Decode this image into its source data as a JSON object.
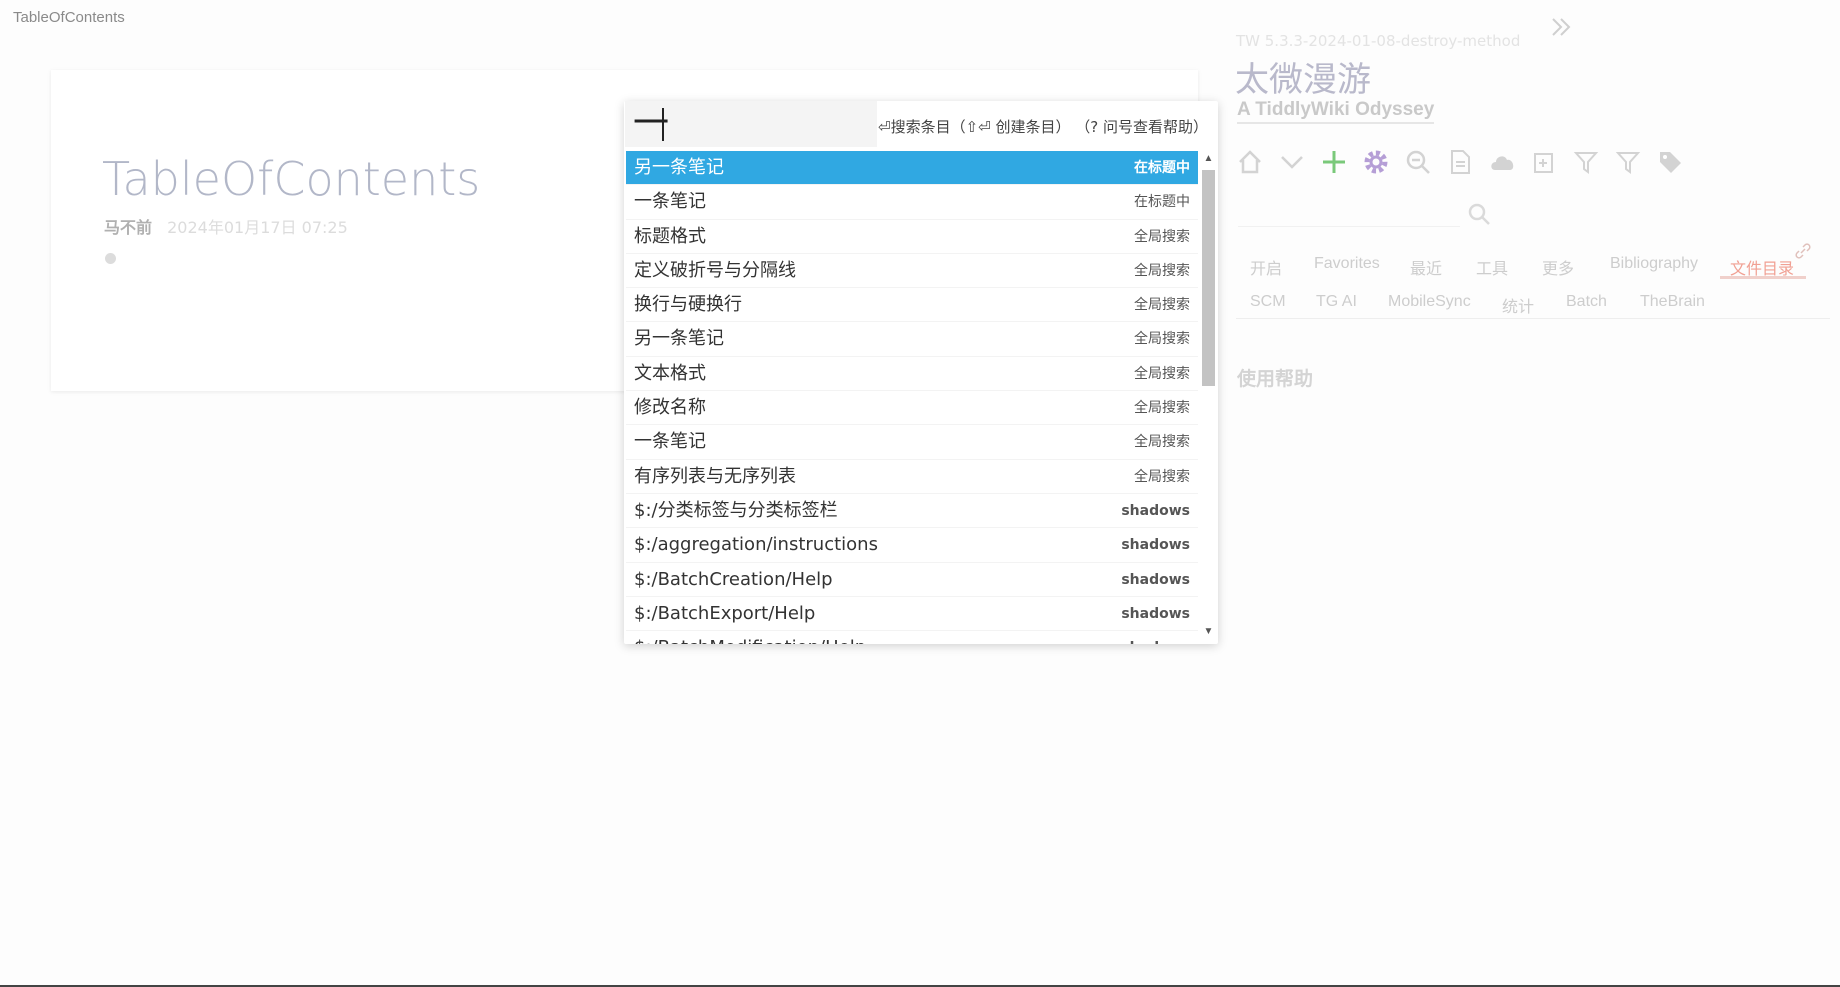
{
  "window": {
    "title": "TableOfContents"
  },
  "tiddler": {
    "title": "TableOfContents",
    "author": "马不前",
    "date": "2024年01月17日 07:25"
  },
  "sidebar": {
    "version": "TW 5.3.3-2024-01-08-destroy-method",
    "site_title": "太微漫游",
    "site_subtitle": "A TiddlyWiki Odyssey",
    "toolbar_icons": [
      "home-icon",
      "chevron-down-icon",
      "plus-icon",
      "gear-icon",
      "zoom-out-icon",
      "document-icon",
      "cloud-icon",
      "new-tiddler-icon",
      "filter-icon",
      "filter-icon",
      "tag-icon"
    ],
    "tabs_row1": [
      "开启",
      "Favorites",
      "最近",
      "工具",
      "更多",
      "Bibliography",
      "文件目录"
    ],
    "tabs_row2": [
      "SCM",
      "TG AI",
      "MobileSync",
      "统计",
      "Batch",
      "TheBrain"
    ],
    "active_tab": "文件目录",
    "help_label": "使用帮助"
  },
  "search_popup": {
    "input_value": "一",
    "hint": "⏎搜索条目（⇧⏎ 创建条目） （? 问号查看帮助）",
    "results": [
      {
        "title": "另一条笔记",
        "tag": "在标题中",
        "selected": true
      },
      {
        "title": "一条笔记",
        "tag": "在标题中"
      },
      {
        "title": "标题格式",
        "tag": "全局搜索"
      },
      {
        "title": "定义破折号与分隔线",
        "tag": "全局搜索"
      },
      {
        "title": "换行与硬换行",
        "tag": "全局搜索"
      },
      {
        "title": "另一条笔记",
        "tag": "全局搜索"
      },
      {
        "title": "文本格式",
        "tag": "全局搜索"
      },
      {
        "title": "修改名称",
        "tag": "全局搜索"
      },
      {
        "title": "一条笔记",
        "tag": "全局搜索"
      },
      {
        "title": "有序列表与无序列表",
        "tag": "全局搜索"
      },
      {
        "title": "$:/分类标签与分类标签栏",
        "tag": "shadows"
      },
      {
        "title": "$:/aggregation/instructions",
        "tag": "shadows"
      },
      {
        "title": "$:/BatchCreation/Help",
        "tag": "shadows"
      },
      {
        "title": "$:/BatchExport/Help",
        "tag": "shadows"
      },
      {
        "title": "$:/BatchModification/Help",
        "tag": "shadows"
      }
    ]
  },
  "colors": {
    "selected_row": "#30a8e2",
    "active_tab": "#f1a093",
    "plus_icon": "#7ac97a",
    "gear_icon": "#b59ed6"
  }
}
